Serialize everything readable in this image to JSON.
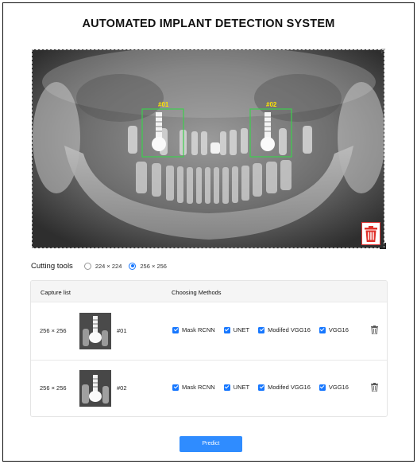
{
  "page": {
    "title": "AUTOMATED IMPLANT DETECTION SYSTEM"
  },
  "viewer": {
    "image_name": "panoramic-dental-xray",
    "detections": [
      {
        "label": "#01",
        "color": "#3ccf4e"
      },
      {
        "label": "#02",
        "color": "#3ccf4e"
      }
    ],
    "label_color": "#ffe600",
    "delete_icon": "trash-icon",
    "delete_icon_color": "#e0312b"
  },
  "cutting_tools": {
    "label": "Cutting tools",
    "options": [
      {
        "label": "224 × 224",
        "selected": false
      },
      {
        "label": "256 × 256",
        "selected": true
      }
    ]
  },
  "capture_table": {
    "headers": {
      "capture": "Capture list",
      "methods": "Choosing Methods"
    },
    "rows": [
      {
        "size": "256 × 256",
        "id": "#01",
        "methods": [
          {
            "label": "Mask RCNN",
            "checked": true
          },
          {
            "label": "UNET",
            "checked": true
          },
          {
            "label": "Modifed VGG16",
            "checked": true
          },
          {
            "label": "VGG16",
            "checked": true
          }
        ],
        "delete_icon": "trash-icon"
      },
      {
        "size": "256 × 256",
        "id": "#02",
        "methods": [
          {
            "label": "Mask RCNN",
            "checked": true
          },
          {
            "label": "UNET",
            "checked": true
          },
          {
            "label": "Modifed VGG16",
            "checked": true
          },
          {
            "label": "VGG16",
            "checked": true
          }
        ],
        "delete_icon": "trash-icon"
      }
    ]
  },
  "actions": {
    "predict_label": "Predict"
  },
  "colors": {
    "accent": "#1677ff",
    "button": "#2f8cff",
    "box": "#3ccf4e"
  }
}
